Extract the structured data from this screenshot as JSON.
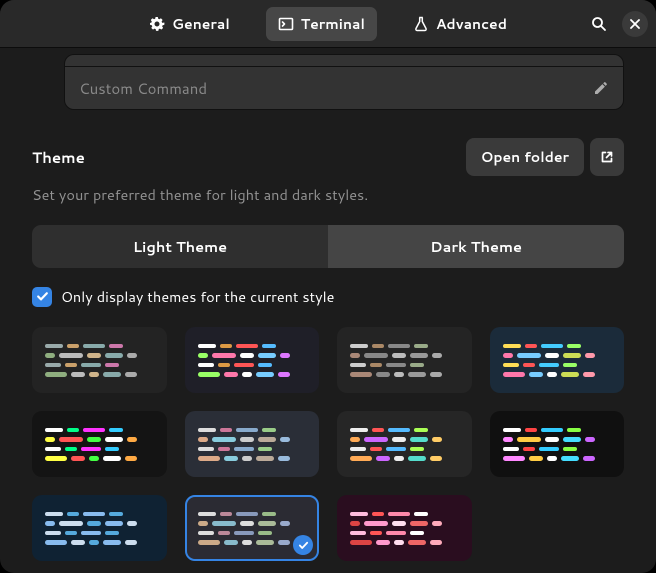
{
  "header": {
    "tabs": [
      {
        "id": "general",
        "label": "General",
        "active": false
      },
      {
        "id": "terminal",
        "label": "Terminal",
        "active": true
      },
      {
        "id": "advanced",
        "label": "Advanced",
        "active": false
      }
    ]
  },
  "custom_command": {
    "placeholder": "Custom Command",
    "value": ""
  },
  "theme": {
    "title": "Theme",
    "subtitle": "Set your preferred theme for light and dark styles.",
    "open_folder_label": "Open folder",
    "mode_segments": {
      "light": "Light Theme",
      "dark": "Dark Theme"
    },
    "active_mode": "dark",
    "filter_checkbox": {
      "label": "Only display themes for the current style",
      "checked": true
    },
    "swatches": [
      {
        "id": "darkgray-pastel",
        "bg": "#232323",
        "selected": false
      },
      {
        "id": "dark-vivid-blue",
        "bg": "#1f1f28",
        "selected": false
      },
      {
        "id": "dark-muted",
        "bg": "#242424",
        "selected": false
      },
      {
        "id": "navy-colorful",
        "bg": "#1b2b3a",
        "selected": false
      },
      {
        "id": "black-neon",
        "bg": "#141414",
        "selected": false
      },
      {
        "id": "slate-soft",
        "bg": "#2a2e37",
        "selected": false
      },
      {
        "id": "charcoal-rainbow",
        "bg": "#262626",
        "selected": false
      },
      {
        "id": "black-rainbow",
        "bg": "#101010",
        "selected": false
      },
      {
        "id": "deep-blue",
        "bg": "#0f2233",
        "selected": false
      },
      {
        "id": "gray-selected",
        "bg": "#2b2b33",
        "selected": true
      },
      {
        "id": "maroon",
        "bg": "#2a0d1f",
        "selected": false
      }
    ]
  }
}
